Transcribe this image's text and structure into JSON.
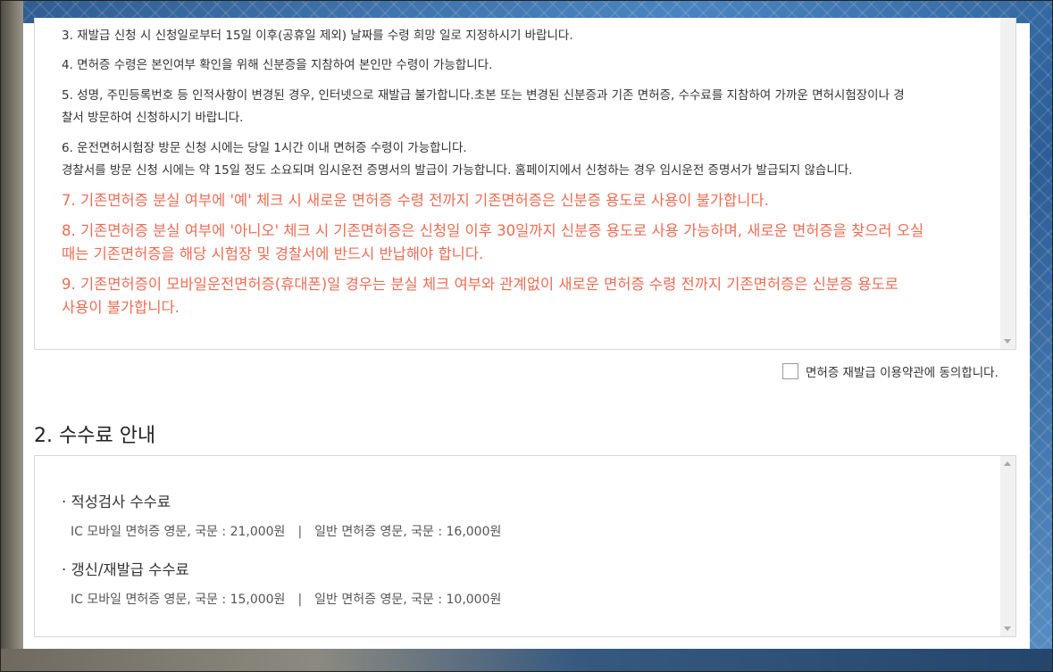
{
  "terms": {
    "items": [
      "3. 재발급 신청 시 신청일로부터 15일 이후(공휴일 제외) 날짜를 수령 희망 일로 지정하시기 바랍니다.",
      "4. 면허증 수령은 본인여부 확인을 위해 신분증을 지참하여 본인만 수령이 가능합니다.",
      "5. 성명, 주민등록번호 등 인적사항이 변경된 경우, 인터넷으로 재발급 불가합니다.초본 또는 변경된 신분증과 기존 면허증, 수수료를 지참하여 가까운 면허시험장이나 경",
      "찰서 방문하여 신청하시기 바랍니다.",
      "6. 운전면허시험장 방문 신청 시에는 당일 1시간 이내 면허증 수령이 가능합니다.",
      "경찰서를 방문 신청 시에는 약 15일 정도 소요되며 임시운전 증명서의 발급이 가능합니다. 홈페이지에서 신청하는 경우 임시운전 증명서가 발급되지 않습니다."
    ],
    "red_items": [
      "7. 기존면허증 분실 여부에 '예' 체크 시 새로운 면허증 수령 전까지 기존면허증은 신분증 용도로 사용이 불가합니다.",
      "8. 기존면허증 분실 여부에 '아니오' 체크 시 기존면허증은 신청일 이후 30일까지 신분증 용도로 사용 가능하며, 새로운 면허증을 찾으러 오실",
      "때는 기존면허증을 해당 시험장 및 경찰서에 반드시 반납해야 합니다.",
      "9. 기존면허증이 모바일운전면허증(휴대폰)일 경우는 분실 체크 여부와 관계없이 새로운 면허증 수령 전까지 기존면허증은 신분증 용도로",
      "사용이 불가합니다."
    ]
  },
  "agree": {
    "label": "면허증 재발급 이용약관에 동의합니다.",
    "checked": false
  },
  "fees": {
    "title": "2. 수수료 안내",
    "aptitude": {
      "title": "· 적성검사 수수료",
      "ic": "IC 모바일 면허증 영문, 국문 : 21,000원",
      "separator": "|",
      "normal": "일반 면허증 영문, 국문 : 16,000원"
    },
    "renewal": {
      "title": "· 갱신/재발급 수수료",
      "ic": "IC 모바일 면허증 영문, 국문 : 15,000원",
      "separator": "|",
      "normal": "일반 면허증 영문, 국문 : 10,000원"
    }
  },
  "colors": {
    "warning": "#ef6c54",
    "text": "#333333",
    "border": "#d7d7d7"
  }
}
